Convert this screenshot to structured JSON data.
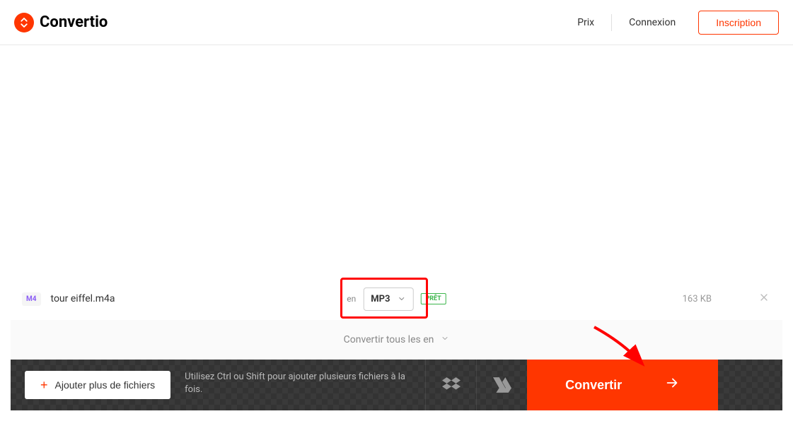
{
  "header": {
    "brand": "Convertio",
    "nav": {
      "pricing": "Prix",
      "login": "Connexion",
      "signup": "Inscription"
    }
  },
  "file": {
    "type_badge": "M4",
    "name": "tour eiffel.m4a",
    "to_label": "en",
    "target_format": "MP3",
    "status": "PRÊT",
    "size": "163 KB"
  },
  "convert_all": {
    "label": "Convertir tous les en"
  },
  "bottom": {
    "add_more": "Ajouter plus de fichiers",
    "hint": "Utilisez Ctrl ou Shift pour ajouter plusieurs fichiers à la fois.",
    "convert": "Convertir"
  }
}
